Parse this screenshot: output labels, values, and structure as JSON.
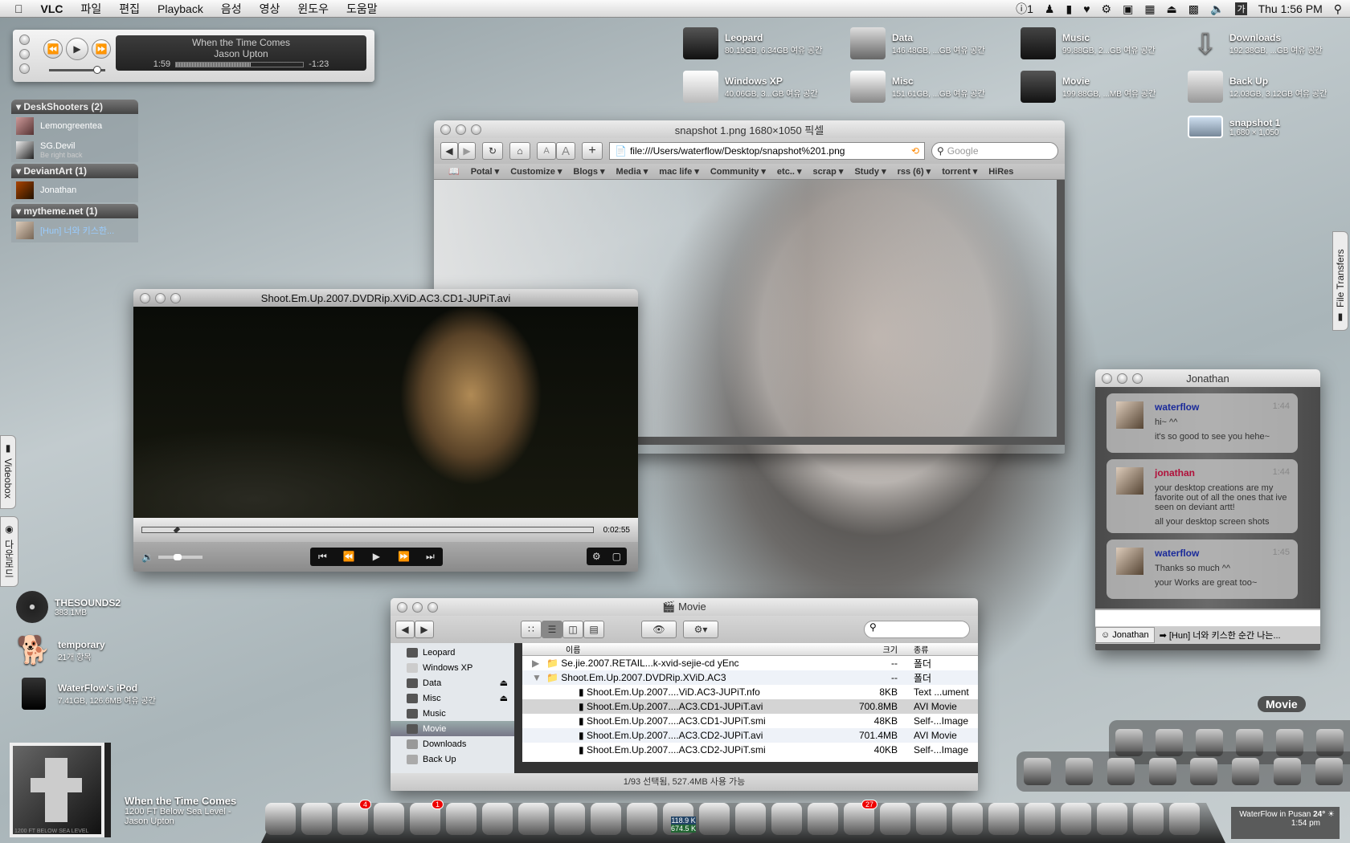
{
  "menubar": {
    "app": "VLC",
    "items": [
      "파일",
      "편집",
      "Playback",
      "음성",
      "영상",
      "윈도우",
      "도움말"
    ],
    "status_count": "1",
    "clock": "Thu 1:56 PM",
    "icons": [
      "apple-icon",
      "alert-icon",
      "user-icon",
      "note-icon",
      "heart-icon",
      "gears-icon",
      "monitor-icon",
      "spaces-icon",
      "eject-icon",
      "display-icon",
      "volume-icon",
      "input-method-icon",
      "spotlight-icon"
    ],
    "input_method": "가"
  },
  "itunes": {
    "song": "When the Time Comes",
    "artist": "Jason Upton",
    "elapsed": "1:59",
    "remaining": "-1:23",
    "progress": 0.59,
    "volume": 0.85
  },
  "buddies": [
    {
      "group": "DeskShooters (2)",
      "members": [
        {
          "name": "Lemongreentea",
          "status": ""
        },
        {
          "name": "SG.Devil",
          "status": "Be right back"
        }
      ]
    },
    {
      "group": "DeviantArt (1)",
      "members": [
        {
          "name": "Jonathan",
          "status": ""
        }
      ]
    },
    {
      "group": "mytheme.net (1)",
      "members": [
        {
          "name": "[Hun] 너와 키스한...",
          "status": ""
        }
      ]
    }
  ],
  "desktop_top": [
    {
      "name": "Leopard",
      "info": "80.19GB, 6.34GB 여유 공간"
    },
    {
      "name": "Data",
      "info": "146.48GB, ...GB 여유 공간"
    },
    {
      "name": "Music",
      "info": "99.88GB, 2...GB 여유 공간"
    },
    {
      "name": "Downloads",
      "info": "192.38GB, ...GB 여유 공간"
    },
    {
      "name": "Windows XP",
      "info": "40.06GB, 3...GB 여유 공간"
    },
    {
      "name": "Misc",
      "info": "151.61GB, ...GB 여유 공간"
    },
    {
      "name": "Movie",
      "info": "199.88GB, ...MB 여유 공간"
    },
    {
      "name": "Back Up",
      "info": "12.03GB, 3.12GB 여유 공간"
    },
    {
      "name": "snapshot 1",
      "info": "1,680 × 1,050"
    }
  ],
  "desktop_left": [
    {
      "name": "THESOUNDS2",
      "info": "383.1MB"
    },
    {
      "name": "temporary",
      "info": "21개 항목"
    },
    {
      "name": "WaterFlow's iPod",
      "info": "7.41GB, 126.6MB 여유 공간"
    }
  ],
  "now_playing": {
    "title": "When the Time Comes",
    "album": "1200 FT Below Sea Level -",
    "artist": "Jason Upton",
    "cover_text": "1200 FT BELOW SEA LEVEL"
  },
  "browser": {
    "title": "snapshot 1.png 1680×1050 픽셀",
    "url": "file:///Users/waterflow/Desktop/snapshot%201.png",
    "search_placeholder": "Google",
    "bookmarks": [
      "Potal ▾",
      "Customize ▾",
      "Blogs ▾",
      "Media ▾",
      "mac life ▾",
      "Community ▾",
      "etc.. ▾",
      "scrap ▾",
      "Study ▾",
      "rss (6) ▾",
      "torrent ▾",
      "HiRes"
    ],
    "text_small": "A",
    "text_large": "A",
    "add": "+"
  },
  "video": {
    "title": "Shoot.Em.Up.2007.DVDRip.XViD.AC3.CD1-JUPiT.avi",
    "time": "0:02:55",
    "progress": 0.07,
    "volume": 0.35
  },
  "finder": {
    "title": "Movie",
    "status": "1/93 선택됨, 527.4MB 사용 가능",
    "sidebar": [
      {
        "name": "Leopard"
      },
      {
        "name": "Windows XP"
      },
      {
        "name": "Data",
        "eject": "⏏"
      },
      {
        "name": "Misc",
        "eject": "⏏"
      },
      {
        "name": "Music"
      },
      {
        "name": "Movie",
        "selected": true
      },
      {
        "name": "Downloads"
      },
      {
        "name": "Back Up"
      }
    ],
    "columns": {
      "name": "이름",
      "size": "크기",
      "kind": "종류"
    },
    "rows": [
      {
        "name": "Se.jie.2007.RETAIL...k-xvid-sejie-cd yEnc",
        "size": "--",
        "kind": "폴더",
        "level": 0,
        "disclosure": "▶"
      },
      {
        "name": "Shoot.Em.Up.2007.DVDRip.XViD.AC3",
        "size": "--",
        "kind": "폴더",
        "level": 0,
        "disclosure": "▼"
      },
      {
        "name": "Shoot.Em.Up.2007....ViD.AC3-JUPiT.nfo",
        "size": "8KB",
        "kind": "Text ...ument",
        "level": 1
      },
      {
        "name": "Shoot.Em.Up.2007....AC3.CD1-JUPiT.avi",
        "size": "700.8MB",
        "kind": "AVI Movie",
        "level": 1,
        "selected": true
      },
      {
        "name": "Shoot.Em.Up.2007....AC3.CD1-JUPiT.smi",
        "size": "48KB",
        "kind": "Self-...Image",
        "level": 1
      },
      {
        "name": "Shoot.Em.Up.2007....AC3.CD2-JUPiT.avi",
        "size": "701.4MB",
        "kind": "AVI Movie",
        "level": 1
      },
      {
        "name": "Shoot.Em.Up.2007....AC3.CD2-JUPiT.smi",
        "size": "40KB",
        "kind": "Self-...Image",
        "level": 1
      }
    ]
  },
  "chat": {
    "title": "Jonathan",
    "messages": [
      {
        "from": "waterflow",
        "time": "1:44",
        "lines": [
          "hi~ ^^",
          "it's so good to see you hehe~"
        ]
      },
      {
        "from": "jonathan",
        "time": "1:44",
        "lines": [
          "your desktop creations are my favorite out of all the ones that ive seen on deviant artt!",
          "all your desktop screen shots"
        ]
      },
      {
        "from": "waterflow",
        "time": "1:45",
        "lines": [
          "Thanks so much ^^",
          "your Works are great too~"
        ]
      }
    ],
    "tabs": [
      "Jonathan",
      "[Hun] 너와 키스한 순간 나는..."
    ],
    "colors": {
      "self": "#1a2a9a",
      "other": "#b0103a"
    }
  },
  "drawers": {
    "left": [
      "Videobox",
      "다운로드"
    ],
    "right": "File Transfers"
  },
  "stack_tooltip": "Movie",
  "stacks": {
    "row1": [
      "apple-icon",
      "cube-icon",
      "iphoto-icon",
      "headphones-icon",
      "movie-clapper-icon",
      "screen-icon"
    ],
    "row2": [
      "appstore-icon",
      "mask-icon",
      "papers-icon",
      "laptop-icon",
      "pens-icon",
      "v-poster-icon",
      "red-button-icon",
      "telephone-icon"
    ]
  },
  "dock": {
    "icons": [
      {
        "name": "finder-icon"
      },
      {
        "name": "dashboard-icon"
      },
      {
        "name": "mail-icon",
        "badge": "4"
      },
      {
        "name": "safari-icon"
      },
      {
        "name": "ical-icon",
        "badge": "1"
      },
      {
        "name": "quicktime-icon"
      },
      {
        "name": "iphoto-icon"
      },
      {
        "name": "piano-icon"
      },
      {
        "name": "preview-icon"
      },
      {
        "name": "eightball-icon"
      },
      {
        "name": "magnifier-icon"
      },
      {
        "name": "speaker-icon"
      },
      {
        "name": "mug-icon"
      },
      {
        "name": "network-icon"
      },
      {
        "name": "headset-icon"
      },
      {
        "name": "sphere-icon"
      },
      {
        "name": "appletv-icon",
        "badge": "27"
      },
      {
        "name": "globe-icon"
      },
      {
        "name": "apple-icon"
      },
      {
        "name": "applications-folder-icon"
      },
      {
        "name": "pencil-icon"
      },
      {
        "name": "documents-folder-icon"
      },
      {
        "name": "file-icon"
      },
      {
        "name": "utilities-folder-icon"
      },
      {
        "name": "pictures-icon"
      },
      {
        "name": "trash-icon"
      }
    ],
    "net_up": "118.9 K",
    "net_down": "674.5 K"
  },
  "weather": {
    "location": "WaterFlow in Pusan",
    "temp": "24°",
    "time": "1:54 pm"
  }
}
